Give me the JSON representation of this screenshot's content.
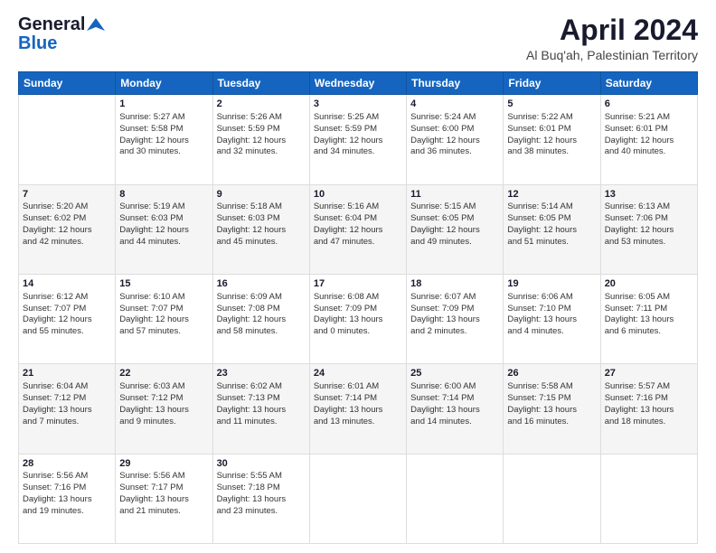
{
  "logo": {
    "line1": "General",
    "line2": "Blue"
  },
  "title": "April 2024",
  "subtitle": "Al Buq'ah, Palestinian Territory",
  "days_header": [
    "Sunday",
    "Monday",
    "Tuesday",
    "Wednesday",
    "Thursday",
    "Friday",
    "Saturday"
  ],
  "weeks": [
    [
      {
        "day": "",
        "info": ""
      },
      {
        "day": "1",
        "info": "Sunrise: 5:27 AM\nSunset: 5:58 PM\nDaylight: 12 hours\nand 30 minutes."
      },
      {
        "day": "2",
        "info": "Sunrise: 5:26 AM\nSunset: 5:59 PM\nDaylight: 12 hours\nand 32 minutes."
      },
      {
        "day": "3",
        "info": "Sunrise: 5:25 AM\nSunset: 5:59 PM\nDaylight: 12 hours\nand 34 minutes."
      },
      {
        "day": "4",
        "info": "Sunrise: 5:24 AM\nSunset: 6:00 PM\nDaylight: 12 hours\nand 36 minutes."
      },
      {
        "day": "5",
        "info": "Sunrise: 5:22 AM\nSunset: 6:01 PM\nDaylight: 12 hours\nand 38 minutes."
      },
      {
        "day": "6",
        "info": "Sunrise: 5:21 AM\nSunset: 6:01 PM\nDaylight: 12 hours\nand 40 minutes."
      }
    ],
    [
      {
        "day": "7",
        "info": "Sunrise: 5:20 AM\nSunset: 6:02 PM\nDaylight: 12 hours\nand 42 minutes."
      },
      {
        "day": "8",
        "info": "Sunrise: 5:19 AM\nSunset: 6:03 PM\nDaylight: 12 hours\nand 44 minutes."
      },
      {
        "day": "9",
        "info": "Sunrise: 5:18 AM\nSunset: 6:03 PM\nDaylight: 12 hours\nand 45 minutes."
      },
      {
        "day": "10",
        "info": "Sunrise: 5:16 AM\nSunset: 6:04 PM\nDaylight: 12 hours\nand 47 minutes."
      },
      {
        "day": "11",
        "info": "Sunrise: 5:15 AM\nSunset: 6:05 PM\nDaylight: 12 hours\nand 49 minutes."
      },
      {
        "day": "12",
        "info": "Sunrise: 5:14 AM\nSunset: 6:05 PM\nDaylight: 12 hours\nand 51 minutes."
      },
      {
        "day": "13",
        "info": "Sunrise: 6:13 AM\nSunset: 7:06 PM\nDaylight: 12 hours\nand 53 minutes."
      }
    ],
    [
      {
        "day": "14",
        "info": "Sunrise: 6:12 AM\nSunset: 7:07 PM\nDaylight: 12 hours\nand 55 minutes."
      },
      {
        "day": "15",
        "info": "Sunrise: 6:10 AM\nSunset: 7:07 PM\nDaylight: 12 hours\nand 57 minutes."
      },
      {
        "day": "16",
        "info": "Sunrise: 6:09 AM\nSunset: 7:08 PM\nDaylight: 12 hours\nand 58 minutes."
      },
      {
        "day": "17",
        "info": "Sunrise: 6:08 AM\nSunset: 7:09 PM\nDaylight: 13 hours\nand 0 minutes."
      },
      {
        "day": "18",
        "info": "Sunrise: 6:07 AM\nSunset: 7:09 PM\nDaylight: 13 hours\nand 2 minutes."
      },
      {
        "day": "19",
        "info": "Sunrise: 6:06 AM\nSunset: 7:10 PM\nDaylight: 13 hours\nand 4 minutes."
      },
      {
        "day": "20",
        "info": "Sunrise: 6:05 AM\nSunset: 7:11 PM\nDaylight: 13 hours\nand 6 minutes."
      }
    ],
    [
      {
        "day": "21",
        "info": "Sunrise: 6:04 AM\nSunset: 7:12 PM\nDaylight: 13 hours\nand 7 minutes."
      },
      {
        "day": "22",
        "info": "Sunrise: 6:03 AM\nSunset: 7:12 PM\nDaylight: 13 hours\nand 9 minutes."
      },
      {
        "day": "23",
        "info": "Sunrise: 6:02 AM\nSunset: 7:13 PM\nDaylight: 13 hours\nand 11 minutes."
      },
      {
        "day": "24",
        "info": "Sunrise: 6:01 AM\nSunset: 7:14 PM\nDaylight: 13 hours\nand 13 minutes."
      },
      {
        "day": "25",
        "info": "Sunrise: 6:00 AM\nSunset: 7:14 PM\nDaylight: 13 hours\nand 14 minutes."
      },
      {
        "day": "26",
        "info": "Sunrise: 5:58 AM\nSunset: 7:15 PM\nDaylight: 13 hours\nand 16 minutes."
      },
      {
        "day": "27",
        "info": "Sunrise: 5:57 AM\nSunset: 7:16 PM\nDaylight: 13 hours\nand 18 minutes."
      }
    ],
    [
      {
        "day": "28",
        "info": "Sunrise: 5:56 AM\nSunset: 7:16 PM\nDaylight: 13 hours\nand 19 minutes."
      },
      {
        "day": "29",
        "info": "Sunrise: 5:56 AM\nSunset: 7:17 PM\nDaylight: 13 hours\nand 21 minutes."
      },
      {
        "day": "30",
        "info": "Sunrise: 5:55 AM\nSunset: 7:18 PM\nDaylight: 13 hours\nand 23 minutes."
      },
      {
        "day": "",
        "info": ""
      },
      {
        "day": "",
        "info": ""
      },
      {
        "day": "",
        "info": ""
      },
      {
        "day": "",
        "info": ""
      }
    ]
  ]
}
